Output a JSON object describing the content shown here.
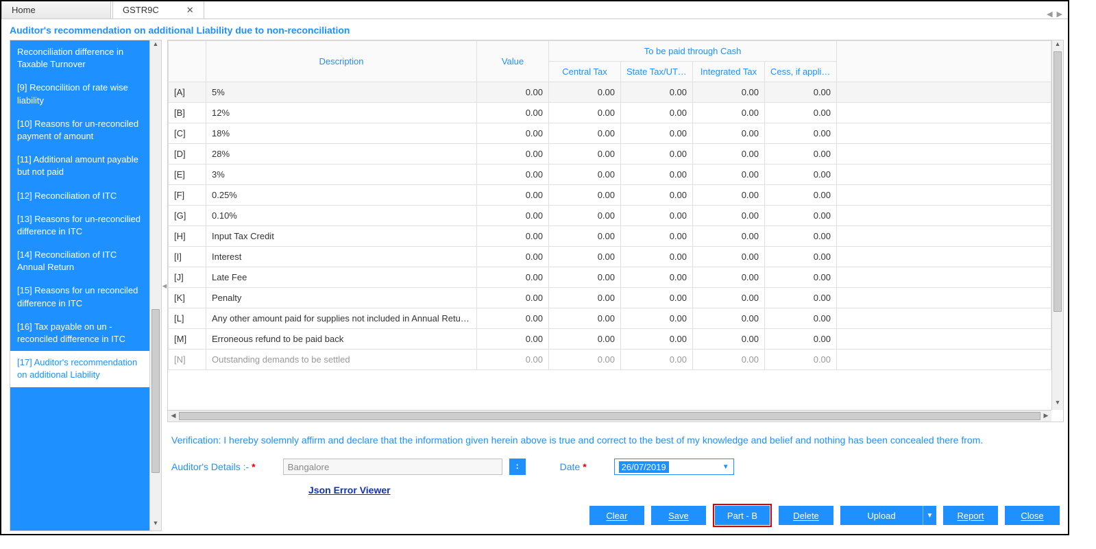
{
  "tabs": {
    "home": "Home",
    "active": "GSTR9C"
  },
  "page_title": "Auditor's recommendation on additional Liability due to non-reconciliation",
  "sidebar": {
    "items": [
      {
        "label": "Reconciliation difference in Taxable Turnover"
      },
      {
        "label": "[9] Reconcilition of rate wise liability"
      },
      {
        "label": "[10] Reasons for un-reconciled payment of amount"
      },
      {
        "label": "[11] Additional amount payable but not paid"
      },
      {
        "label": "[12] Reconciliation of ITC"
      },
      {
        "label": "[13] Reasons for un-reconcilied difference in ITC"
      },
      {
        "label": "[14] Reconciliation of ITC Annual Return"
      },
      {
        "label": "[15] Reasons for un reconciled difference in ITC"
      },
      {
        "label": "[16] Tax payable on un - reconciled difference in ITC"
      },
      {
        "label": "[17] Auditor's recommendation on additional Liability"
      }
    ],
    "active_index": 9
  },
  "table": {
    "group_header": "To be paid through Cash",
    "headers": {
      "idx": "",
      "desc": "Description",
      "value": "Value",
      "ctax": "Central Tax",
      "stax": "State Tax/UT Tax",
      "itax": "Integrated Tax",
      "cess": "Cess, if applicable"
    },
    "rows": [
      {
        "idx": "[A]",
        "desc": "5%",
        "value": "0.00",
        "ctax": "0.00",
        "stax": "0.00",
        "itax": "0.00",
        "cess": "0.00"
      },
      {
        "idx": "[B]",
        "desc": "12%",
        "value": "0.00",
        "ctax": "0.00",
        "stax": "0.00",
        "itax": "0.00",
        "cess": "0.00"
      },
      {
        "idx": "[C]",
        "desc": "18%",
        "value": "0.00",
        "ctax": "0.00",
        "stax": "0.00",
        "itax": "0.00",
        "cess": "0.00"
      },
      {
        "idx": "[D]",
        "desc": "28%",
        "value": "0.00",
        "ctax": "0.00",
        "stax": "0.00",
        "itax": "0.00",
        "cess": "0.00"
      },
      {
        "idx": "[E]",
        "desc": "3%",
        "value": "0.00",
        "ctax": "0.00",
        "stax": "0.00",
        "itax": "0.00",
        "cess": "0.00"
      },
      {
        "idx": "[F]",
        "desc": "0.25%",
        "value": "0.00",
        "ctax": "0.00",
        "stax": "0.00",
        "itax": "0.00",
        "cess": "0.00"
      },
      {
        "idx": "[G]",
        "desc": "0.10%",
        "value": "0.00",
        "ctax": "0.00",
        "stax": "0.00",
        "itax": "0.00",
        "cess": "0.00"
      },
      {
        "idx": "[H]",
        "desc": "Input Tax Credit",
        "value": "0.00",
        "ctax": "0.00",
        "stax": "0.00",
        "itax": "0.00",
        "cess": "0.00"
      },
      {
        "idx": "[I]",
        "desc": "Interest",
        "value": "0.00",
        "ctax": "0.00",
        "stax": "0.00",
        "itax": "0.00",
        "cess": "0.00"
      },
      {
        "idx": "[J]",
        "desc": "Late Fee",
        "value": "0.00",
        "ctax": "0.00",
        "stax": "0.00",
        "itax": "0.00",
        "cess": "0.00"
      },
      {
        "idx": "[K]",
        "desc": "Penalty",
        "value": "0.00",
        "ctax": "0.00",
        "stax": "0.00",
        "itax": "0.00",
        "cess": "0.00"
      },
      {
        "idx": "[L]",
        "desc": "Any other amount paid for supplies not included in Annual Return…",
        "value": "0.00",
        "ctax": "0.00",
        "stax": "0.00",
        "itax": "0.00",
        "cess": "0.00"
      },
      {
        "idx": "[M]",
        "desc": "Erroneous refund to be paid back",
        "value": "0.00",
        "ctax": "0.00",
        "stax": "0.00",
        "itax": "0.00",
        "cess": "0.00"
      },
      {
        "idx": "[N]",
        "desc": "Outstanding demands to be settled",
        "value": "0.00",
        "ctax": "0.00",
        "stax": "0.00",
        "itax": "0.00",
        "cess": "0.00"
      }
    ]
  },
  "verification_text": "Verification: I hereby solemnly affirm and declare that the information given herein above is true and correct to the best of my knowledge and belief and nothing has been concealed there from.",
  "auditor": {
    "label": "Auditor's Details :-",
    "value": "Bangalore",
    "button": ":",
    "date_label": "Date",
    "date_value": "26/07/2019"
  },
  "link": "Json Error Viewer",
  "buttons": {
    "clear": "Clear",
    "save": "Save",
    "partb": "Part - B",
    "delete": "Delete",
    "upload": "Upload",
    "report": "Report",
    "close": "Close"
  }
}
